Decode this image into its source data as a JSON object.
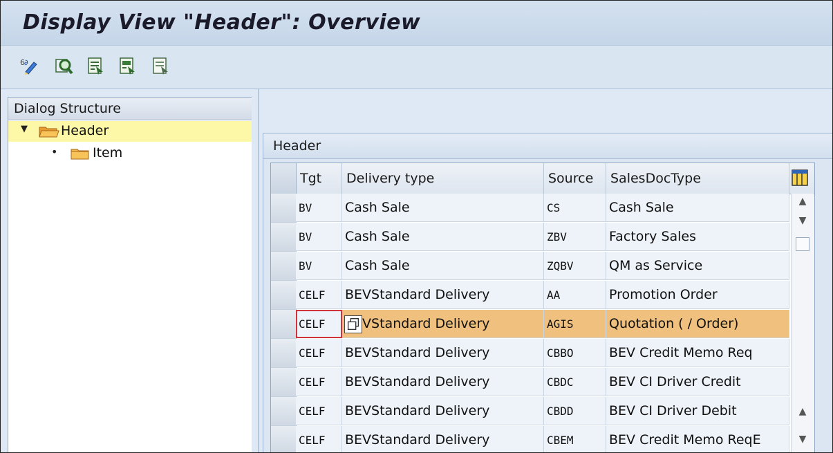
{
  "title": "Display View \"Header\": Overview",
  "toolbar": {
    "buttons": [
      {
        "name": "change-display-icon"
      },
      {
        "name": "find-icon"
      },
      {
        "name": "select-all-icon"
      },
      {
        "name": "select-block-icon"
      },
      {
        "name": "deselect-all-icon"
      }
    ]
  },
  "dialog_structure": {
    "heading": "Dialog Structure",
    "nodes": [
      {
        "label": "Header",
        "expanded": true,
        "selected": true
      },
      {
        "label": "Item",
        "expanded": false,
        "selected": false
      }
    ]
  },
  "group": {
    "title": "Header"
  },
  "table": {
    "columns": [
      "Tgt",
      "Delivery type",
      "Source",
      "SalesDocType"
    ],
    "rows": [
      [
        "BV",
        "Cash Sale",
        "CS",
        "Cash Sale"
      ],
      [
        "BV",
        "Cash Sale",
        "ZBV",
        "Factory Sales"
      ],
      [
        "BV",
        "Cash Sale",
        "ZQBV",
        "QM as Service"
      ],
      [
        "CELF",
        "BEVStandard Delivery",
        "AA",
        "Promotion Order"
      ],
      [
        "CELF",
        "BEVStandard Delivery",
        "AGIS",
        "Quotation ( / Order)"
      ],
      [
        "CELF",
        "BEVStandard Delivery",
        "CBBO",
        "BEV Credit Memo Req"
      ],
      [
        "CELF",
        "BEVStandard Delivery",
        "CBDC",
        "BEV CI Driver Credit"
      ],
      [
        "CELF",
        "BEVStandard Delivery",
        "CBDD",
        "BEV CI Driver Debit"
      ],
      [
        "CELF",
        "BEVStandard Delivery",
        "CBEM",
        "BEV Credit Memo ReqE"
      ]
    ],
    "highlighted_row": 4
  },
  "colors": {
    "highlight": "#f0c07e",
    "tree_selected": "#fdf8a7",
    "focus": "#d0343a"
  }
}
